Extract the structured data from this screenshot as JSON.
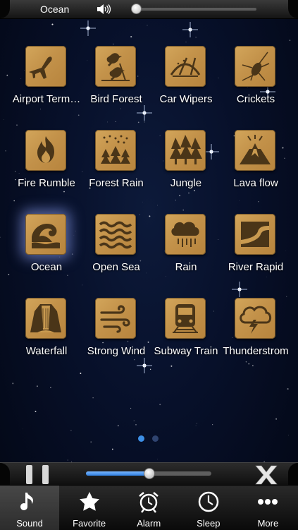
{
  "now_playing": {
    "title": "Ocean",
    "icon": "speaker-icon",
    "progress": 0.0
  },
  "sounds": [
    {
      "label": "Airport Term…",
      "icon": "airplane-icon"
    },
    {
      "label": "Bird Forest",
      "icon": "birds-icon"
    },
    {
      "label": "Car Wipers",
      "icon": "windshield-wiper-icon"
    },
    {
      "label": "Crickets",
      "icon": "cricket-icon"
    },
    {
      "label": "Fire Rumble",
      "icon": "fire-icon"
    },
    {
      "label": "Forest Rain",
      "icon": "rain-trees-icon"
    },
    {
      "label": "Jungle",
      "icon": "trees-icon"
    },
    {
      "label": "Lava flow",
      "icon": "volcano-icon"
    },
    {
      "label": "Ocean",
      "icon": "wave-icon",
      "selected": true
    },
    {
      "label": "Open Sea",
      "icon": "sea-waves-icon"
    },
    {
      "label": "Rain",
      "icon": "rain-cloud-icon"
    },
    {
      "label": "River Rapid",
      "icon": "river-icon"
    },
    {
      "label": "Waterfall",
      "icon": "waterfall-icon"
    },
    {
      "label": "Strong Wind",
      "icon": "wind-icon"
    },
    {
      "label": "Subway Train",
      "icon": "train-icon"
    },
    {
      "label": "Thunderstrom",
      "icon": "thunder-cloud-icon"
    }
  ],
  "pagination": {
    "pages": 2,
    "current": 1
  },
  "player": {
    "volume": 0.5
  },
  "tabs": [
    {
      "label": "Sound",
      "icon": "music-note-icon",
      "active": true
    },
    {
      "label": "Favorite",
      "icon": "star-icon"
    },
    {
      "label": "Alarm",
      "icon": "alarm-clock-icon"
    },
    {
      "label": "Sleep",
      "icon": "clock-icon"
    },
    {
      "label": "More",
      "icon": "more-dots-icon"
    }
  ],
  "colors": {
    "tile": "#c99a50",
    "icon": "#4a3518",
    "accent": "#3d8fe6",
    "background": "#07102a"
  }
}
